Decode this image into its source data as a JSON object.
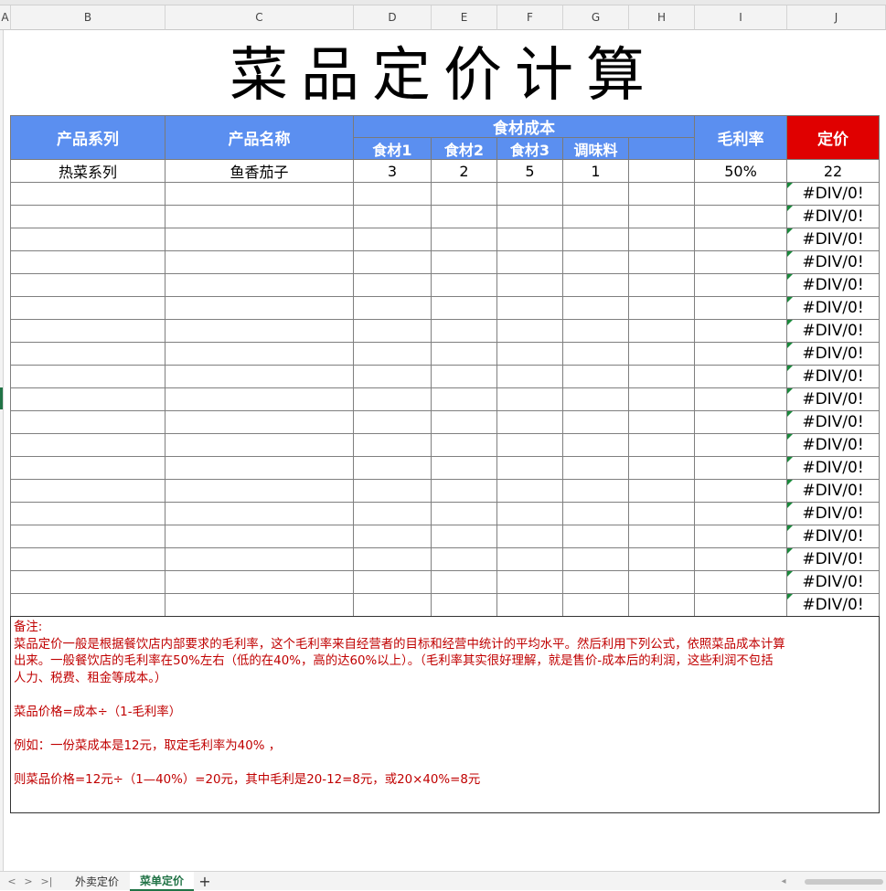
{
  "columns": [
    "A",
    "B",
    "C",
    "D",
    "E",
    "F",
    "G",
    "H",
    "I",
    "J"
  ],
  "title": "菜品定价计算",
  "header": {
    "series": "产品系列",
    "name": "产品名称",
    "cost_group": "食材成本",
    "cost_cols": [
      "食材1",
      "食材2",
      "食材3",
      "调味料",
      ""
    ],
    "margin": "毛利率",
    "price": "定价"
  },
  "rows": [
    {
      "series": "热菜系列",
      "name": "鱼香茄子",
      "c1": "3",
      "c2": "2",
      "c3": "5",
      "c4": "1",
      "c5": "",
      "margin": "50%",
      "price": "22"
    },
    {
      "price": "#DIV/0!"
    },
    {
      "price": "#DIV/0!"
    },
    {
      "price": "#DIV/0!"
    },
    {
      "price": "#DIV/0!"
    },
    {
      "price": "#DIV/0!"
    },
    {
      "price": "#DIV/0!"
    },
    {
      "price": "#DIV/0!"
    },
    {
      "price": "#DIV/0!"
    },
    {
      "price": "#DIV/0!"
    },
    {
      "price": "#DIV/0!"
    },
    {
      "price": "#DIV/0!"
    },
    {
      "price": "#DIV/0!"
    },
    {
      "price": "#DIV/0!"
    },
    {
      "price": "#DIV/0!"
    },
    {
      "price": "#DIV/0!"
    },
    {
      "price": "#DIV/0!"
    },
    {
      "price": "#DIV/0!"
    },
    {
      "price": "#DIV/0!"
    },
    {
      "price": "#DIV/0!"
    }
  ],
  "notes": {
    "label": "备注:",
    "line1": "菜品定价一般是根据餐饮店内部要求的毛利率，这个毛利率来自经营者的目标和经营中统计的平均水平。然后利用下列公式，依照菜品成本计算",
    "line2": "出来。一般餐饮店的毛利率在50%左右（低的在40%，高的达60%以上）。（毛利率其实很好理解，就是售价-成本后的利润，这些利润不包括",
    "line3": "人力、税费、租金等成本。）",
    "formula": "菜品价格=成本÷（1-毛利率）",
    "example": "例如：一份菜成本是12元，取定毛利率为40% ，",
    "result": "则菜品价格=12元÷（1—40%）=20元，其中毛利是20-12=8元，或20×40%=8元"
  },
  "tabs": {
    "nav": [
      "<",
      ">",
      ">|"
    ],
    "sheet1": "外卖定价",
    "sheet2": "菜单定价",
    "add": "+"
  },
  "colors": {
    "header_blue": "#5b8ff0",
    "price_red": "#e00000",
    "note_red": "#c00000",
    "excel_green": "#217346"
  }
}
